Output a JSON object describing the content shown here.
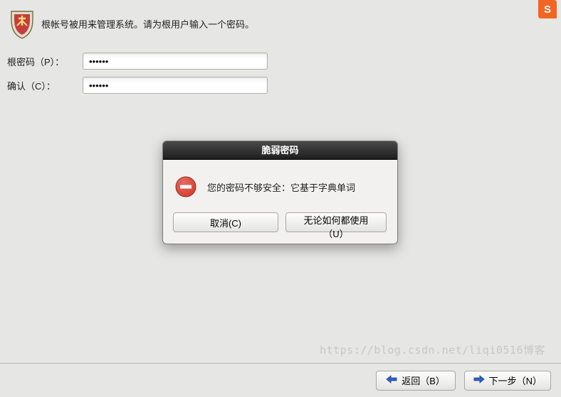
{
  "intro": "根帐号被用来管理系统。请为根用户输入一个密码。",
  "form": {
    "password_label": "根密码（P）：",
    "password_value": "••••••",
    "confirm_label": "确认（C）：",
    "confirm_value": "••••••"
  },
  "dialog": {
    "title": "脆弱密码",
    "message": "您的密码不够安全：它基于字典单词",
    "cancel_label": "取消(C)",
    "use_anyway_label": "无论如何都使用（U）"
  },
  "footer": {
    "back_label": "返回（B）",
    "next_label": "下一步（N）"
  },
  "icons": {
    "shield": "shield-icon",
    "ime": "ime-icon",
    "stop": "stop-icon",
    "arrow_left": "arrow-left-icon",
    "arrow_right": "arrow-right-icon"
  },
  "colors": {
    "stop_red": "#d83a2b",
    "arrow_blue": "#2f62c9",
    "ime_orange": "#f26522"
  },
  "watermark": "https://blog.csdn.net/liqi0516博客"
}
